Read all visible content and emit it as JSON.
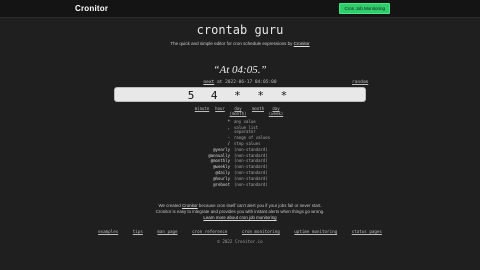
{
  "header": {
    "brand": "Cronitor",
    "cta_label": "Cron Job Monitoring"
  },
  "hero": {
    "title": "crontab guru",
    "subtitle_prefix": "The quick and simple editor for cron schedule expressions by",
    "subtitle_link": "Cronitor"
  },
  "schedule": {
    "human_readable": "“At 04:05.”",
    "next_label": "next",
    "next_text": "at 2022-06-17 04:05:00",
    "random_label": "random",
    "expression": "5 4 * * *"
  },
  "parts": [
    {
      "label": "minute"
    },
    {
      "label": "hour"
    },
    {
      "label": "day\n(month)"
    },
    {
      "label": "month"
    },
    {
      "label": "day\n(week)"
    }
  ],
  "reference": [
    {
      "symbol": "*",
      "desc": "any value"
    },
    {
      "symbol": ",",
      "desc": "value list\nseparator"
    },
    {
      "symbol": "-",
      "desc": "range of values"
    },
    {
      "symbol": "/",
      "desc": "step values"
    },
    {
      "symbol": "@yearly",
      "desc": "(non-standard)"
    },
    {
      "symbol": "@annually",
      "desc": "(non-standard)"
    },
    {
      "symbol": "@monthly",
      "desc": "(non-standard)"
    },
    {
      "symbol": "@weekly",
      "desc": "(non-standard)"
    },
    {
      "symbol": "@daily",
      "desc": "(non-standard)"
    },
    {
      "symbol": "@hourly",
      "desc": "(non-standard)"
    },
    {
      "symbol": "@reboot",
      "desc": "(non-standard)"
    }
  ],
  "about": {
    "line1_a": "We created",
    "line1_link": "Cronitor",
    "line1_b": "because cron itself can't alert you if your jobs fail or never start.",
    "line2_a": "Cronitor is easy to integrate and provides you with instant alerts when things go wrong.",
    "line3_link": "Learn more about cron job monitoring"
  },
  "footer": {
    "links": [
      "examples",
      "tips",
      "man page",
      "cron reference",
      "cron monitoring",
      "uptime monitoring",
      "status pages"
    ],
    "copyright": "© 2022 Cronitor.io"
  }
}
